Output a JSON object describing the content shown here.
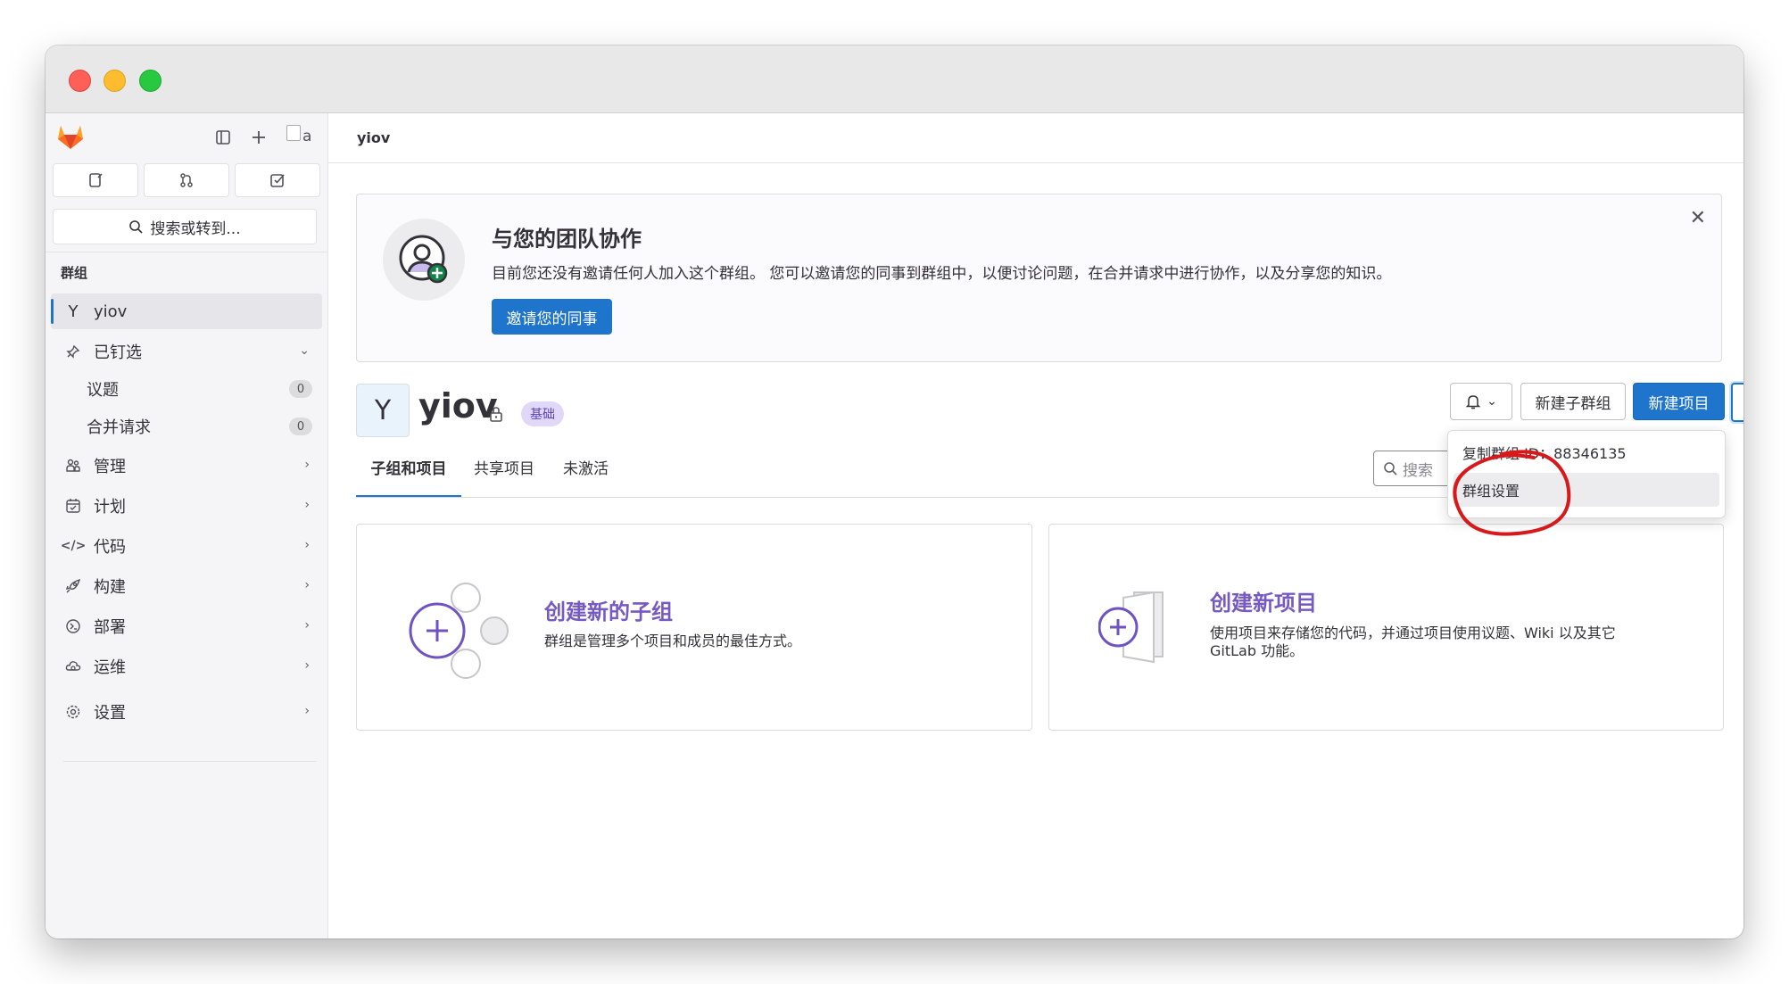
{
  "window": {
    "traffic_lights": [
      "close",
      "minimize",
      "zoom"
    ]
  },
  "sidebar": {
    "search_label": "搜索或转到...",
    "avatar_alt": "a",
    "section_title": "群组",
    "group": {
      "letter": "Y",
      "name": "yiov"
    },
    "pinned": {
      "label": "已钉选",
      "items": [
        {
          "label": "议题",
          "count": "0"
        },
        {
          "label": "合并请求",
          "count": "0"
        }
      ]
    },
    "items": [
      {
        "label": "管理",
        "icon": "users-icon"
      },
      {
        "label": "计划",
        "icon": "calendar-icon"
      },
      {
        "label": "代码",
        "icon": "code-icon"
      },
      {
        "label": "构建",
        "icon": "rocket-icon"
      },
      {
        "label": "部署",
        "icon": "deploy-icon"
      },
      {
        "label": "运维",
        "icon": "cloud-icon"
      },
      {
        "label": "设置",
        "icon": "gear-icon"
      }
    ]
  },
  "breadcrumb": "yiov",
  "banner": {
    "title": "与您的团队协作",
    "text": "目前您还没有邀请任何人加入这个群组。 您可以邀请您的同事到群组中，以便讨论问题，在合并请求中进行协作，以及分享您的知识。",
    "button": "邀请您的同事"
  },
  "group": {
    "letter": "Y",
    "name": "yiov",
    "badge": "基础"
  },
  "actions": {
    "new_subgroup": "新建子群组",
    "new_project": "新建项目"
  },
  "tabs": [
    "子组和项目",
    "共享项目",
    "未激活"
  ],
  "search": {
    "placeholder": "搜索"
  },
  "dropdown": {
    "copy_id": "复制群组 ID：88346135",
    "settings": "群组设置"
  },
  "cards": [
    {
      "title": "创建新的子组",
      "desc": "群组是管理多个项目和成员的最佳方式。"
    },
    {
      "title": "创建新项目",
      "desc_line1": "使用项目来存储您的代码，并通过项目使用议题、Wiki 以及其它",
      "desc_line2": "GitLab 功能。"
    }
  ],
  "colors": {
    "primary": "#1f75cb",
    "accent_purple": "#7759c2",
    "annotation_red": "#d7191c"
  }
}
